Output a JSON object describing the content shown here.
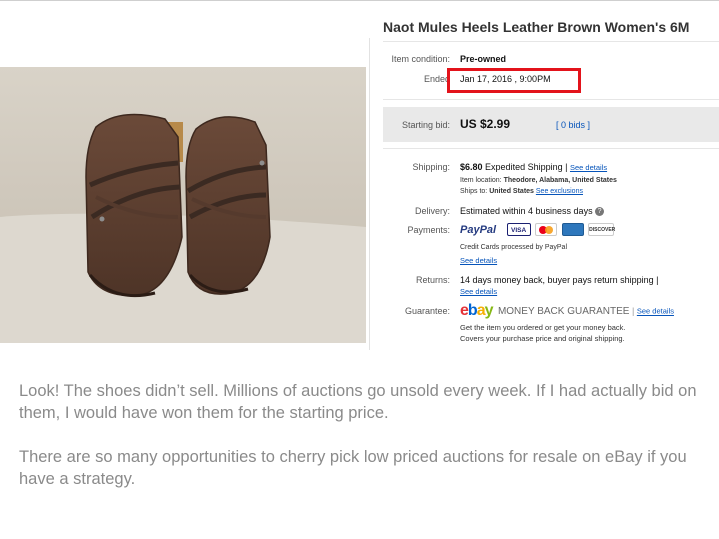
{
  "listing": {
    "title": "Naot Mules Heels Leather Brown Women's 6M",
    "condition_label": "Item condition:",
    "condition_value": "Pre-owned",
    "ended_label": "Ended",
    "ended_value": "Jan 17, 2016 , 9:00PM",
    "starting_bid_label": "Starting bid:",
    "starting_bid_value": "US $2.99",
    "bids_link": "[ 0 bids ]"
  },
  "shipping": {
    "label": "Shipping:",
    "price": "$6.80",
    "method": "Expedited Shipping |",
    "details_link": "See details",
    "location_label": "Item location:",
    "location_value": "Theodore, Alabama, United States",
    "ships_to_label": "Ships to:",
    "ships_to_value": "United States",
    "exclusions_link": "See exclusions"
  },
  "delivery": {
    "label": "Delivery:",
    "value": "Estimated within 4 business days",
    "info_icon": "info-icon"
  },
  "payments": {
    "label": "Payments:",
    "paypal": "PayPal",
    "cards": [
      "VISA",
      "MC",
      "AMEX",
      "DISCOVER"
    ],
    "note": "Credit Cards processed by PayPal",
    "details_link": "See details"
  },
  "returns": {
    "label": "Returns:",
    "value": "14 days money back, buyer pays return shipping |",
    "details_link": "See details"
  },
  "guarantee": {
    "label": "Guarantee:",
    "logo_text": "ebay",
    "money_back": "MONEY BACK GUARANTEE",
    "details_link": "See details",
    "line1": "Get the item you ordered or get your money back.",
    "line2": "Covers your purchase price and original shipping."
  },
  "caption": {
    "para1": "Look! The shoes didn’t sell. Millions of auctions go unsold every week. If I had actually bid on them, I would have won them for the starting price.",
    "para2": "There are so many opportunities to cherry pick low priced auctions for resale on eBay if you have a strategy."
  },
  "colors": {
    "highlight": "#e3131b",
    "link": "#0654ba",
    "caption": "#8a8a8a"
  }
}
